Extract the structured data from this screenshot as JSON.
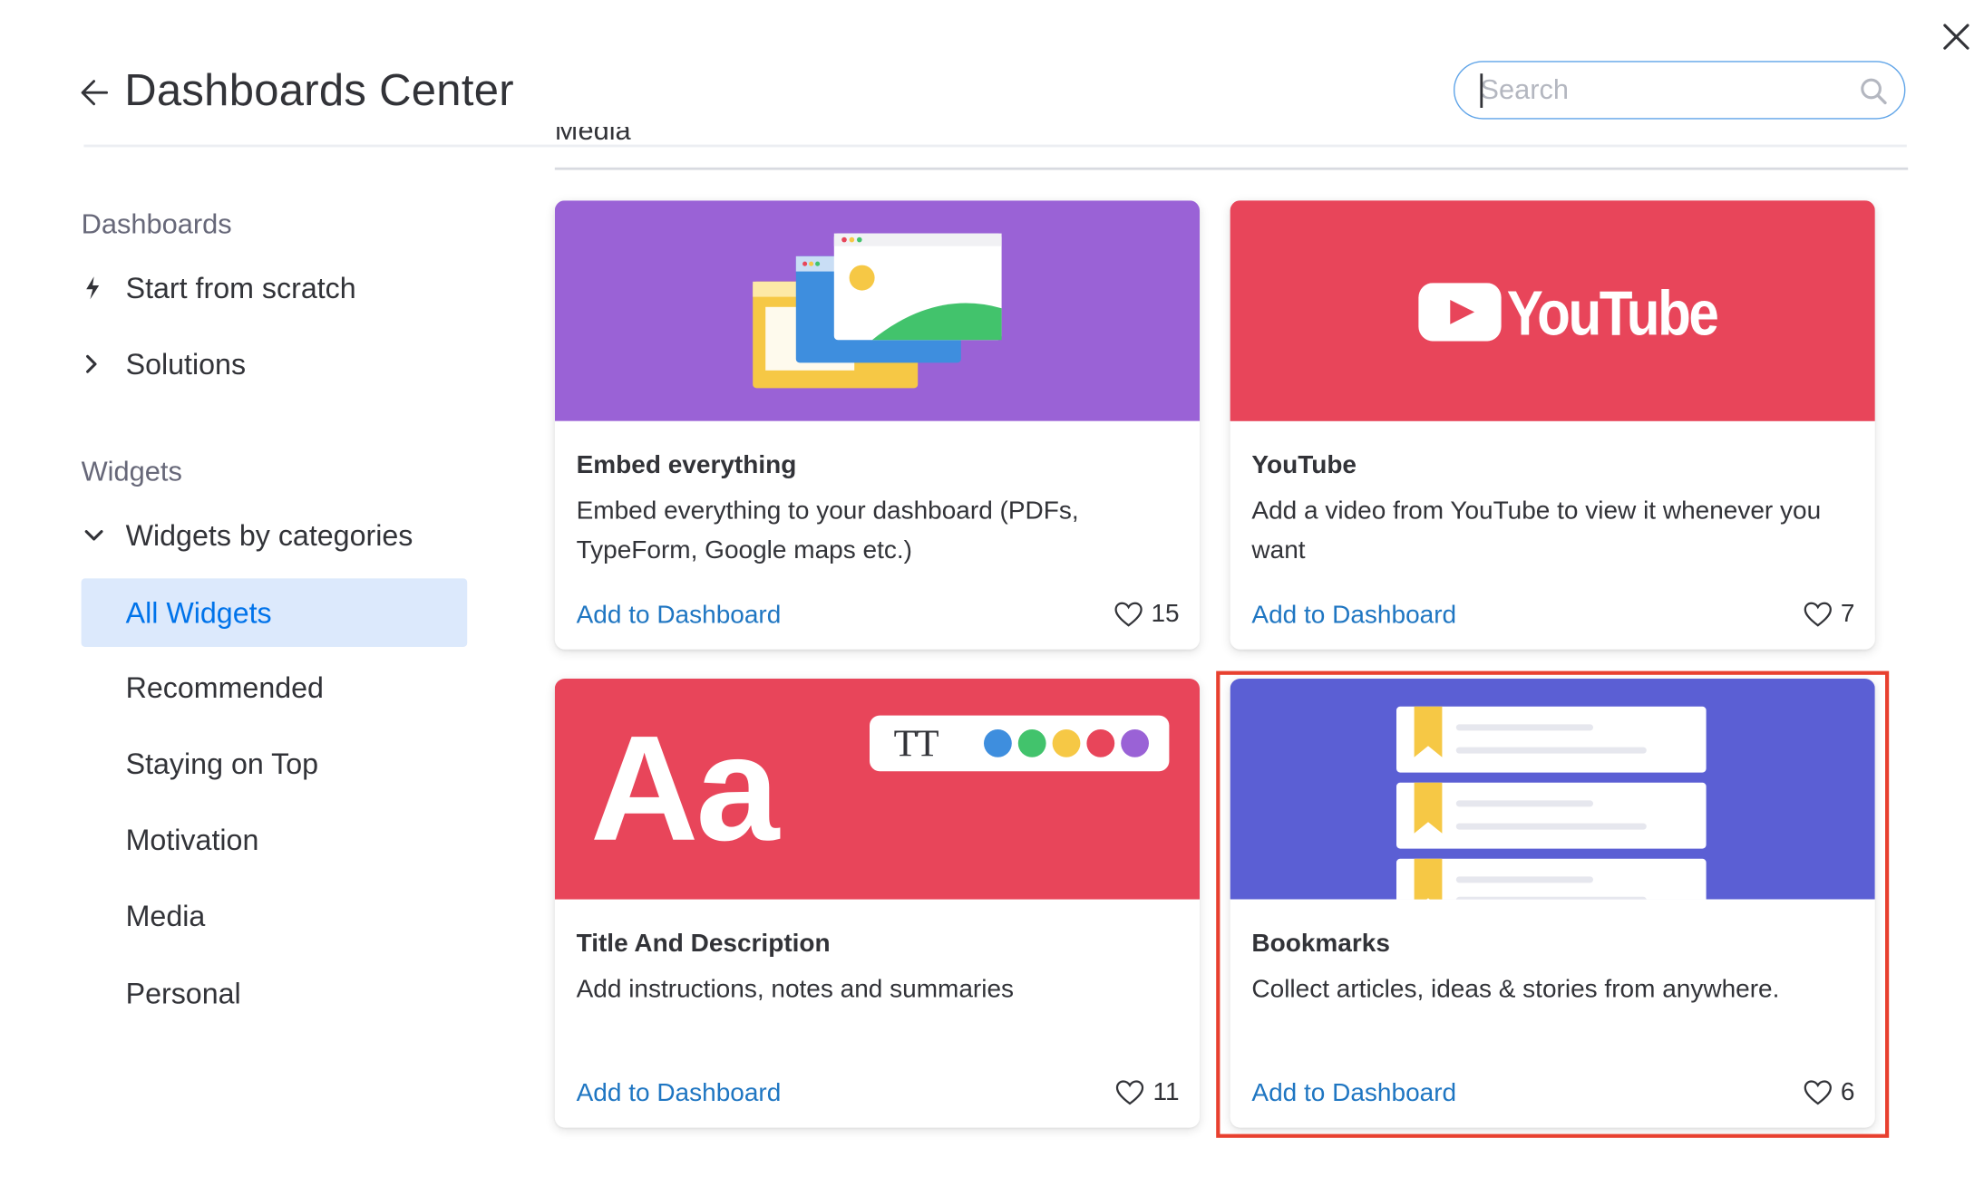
{
  "header": {
    "title": "Dashboards Center",
    "search_placeholder": "Search",
    "search_value": ""
  },
  "section_label": "Media",
  "sidebar": {
    "dashboards_heading": "Dashboards",
    "dashboards_items": [
      {
        "label": "Start from scratch",
        "icon": "lightning-icon"
      },
      {
        "label": "Solutions",
        "icon": "chevron-right-icon"
      }
    ],
    "widgets_heading": "Widgets",
    "widgets_group": {
      "label": "Widgets by categories",
      "icon": "chevron-down-icon"
    },
    "categories": [
      {
        "label": "All Widgets",
        "active": true
      },
      {
        "label": "Recommended",
        "active": false
      },
      {
        "label": "Staying on Top",
        "active": false
      },
      {
        "label": "Motivation",
        "active": false
      },
      {
        "label": "Media",
        "active": false
      },
      {
        "label": "Personal",
        "active": false
      }
    ]
  },
  "cards": [
    {
      "title": "Embed everything",
      "description": "Embed everything to your dashboard (PDFs, TypeForm, Google maps etc.)",
      "action": "Add to Dashboard",
      "likes": "15",
      "banner_color": "#9a62d6"
    },
    {
      "title": "YouTube",
      "description": "Add a video from YouTube to view it whenever you want",
      "action": "Add to Dashboard",
      "likes": "7",
      "banner_color": "#e8455a",
      "banner_logo_text": "YouTube"
    },
    {
      "title": "Title And Description",
      "description": "Add instructions, notes and summaries",
      "action": "Add to Dashboard",
      "likes": "11",
      "banner_color": "#e8455a",
      "banner_big_text": "Aa",
      "banner_chip_text": "TT"
    },
    {
      "title": "Bookmarks",
      "description": "Collect articles, ideas & stories from anywhere.",
      "action": "Add to Dashboard",
      "likes": "6",
      "banner_color": "#5b5fd4",
      "highlighted": true
    }
  ],
  "colors": {
    "accent": "#0073ea",
    "link": "#1f76c2",
    "active_bg": "#dce9fc",
    "highlight_border": "#e8402f"
  }
}
